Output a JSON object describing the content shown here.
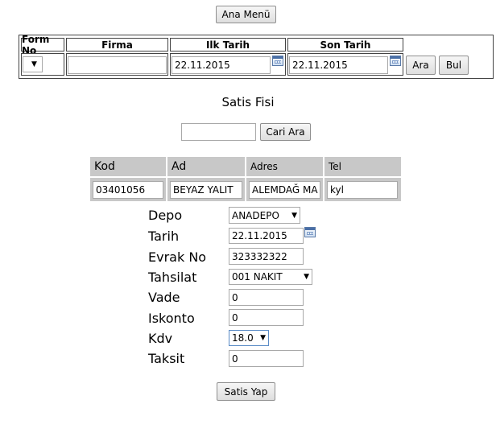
{
  "top": {
    "main_menu_button": "Ana Menü"
  },
  "filter": {
    "headers": [
      "Form No",
      "Firma",
      "Ilk Tarih",
      "Son Tarih"
    ],
    "form_no_value": "",
    "firma_value": "",
    "ilk_tarih_value": "22.11.2015",
    "son_tarih_value": "22.11.2015",
    "ara_button": "Ara",
    "bul_button": "Bul"
  },
  "section": {
    "title": "Satis Fisi",
    "cari_search_value": "",
    "cari_ara_button": "Cari Ara"
  },
  "customer": {
    "headers": [
      "Kod",
      "Ad",
      "Adres",
      "Tel"
    ],
    "kod": "03401056",
    "ad": "BEYAZ YALIT",
    "adres": "ALEMDAĞ MA",
    "tel": "kyl"
  },
  "form": {
    "depo_label": "Depo",
    "depo_value": "ANADEPO",
    "tarih_label": "Tarih",
    "tarih_value": "22.11.2015",
    "evrak_label": "Evrak No",
    "evrak_value": "323332322",
    "tahsilat_label": "Tahsilat",
    "tahsilat_value": "001 NAKIT",
    "vade_label": "Vade",
    "vade_value": "0",
    "iskonto_label": "Iskonto",
    "iskonto_value": "0",
    "kdv_label": "Kdv",
    "kdv_value": "18.0",
    "taksit_label": "Taksit",
    "taksit_value": "0"
  },
  "actions": {
    "satis_yap_button": "Satis Yap"
  }
}
